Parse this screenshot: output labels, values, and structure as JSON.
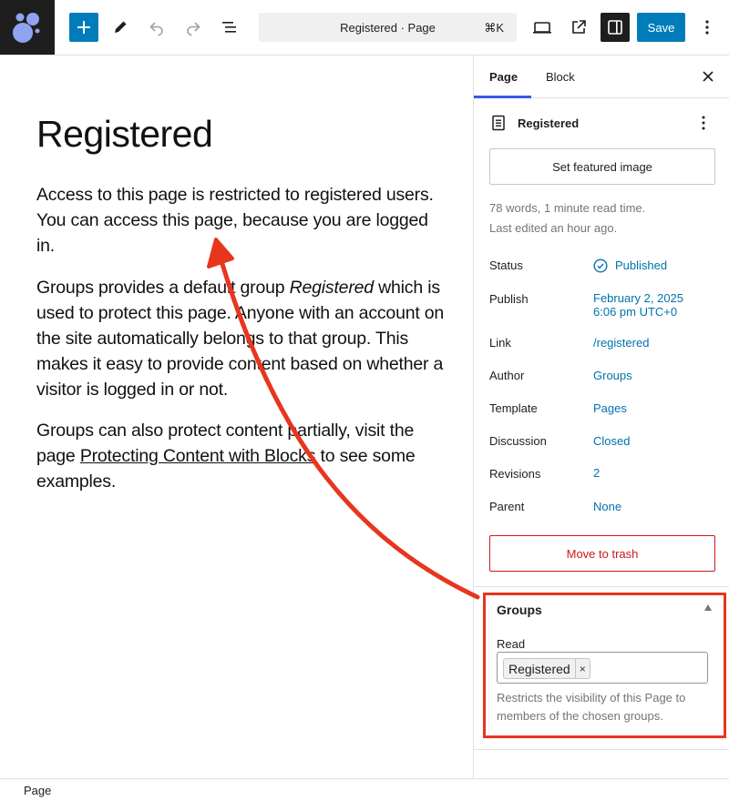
{
  "toolbar": {
    "add_icon": "plus-icon",
    "command_title": "Registered · Page",
    "command_shortcut": "⌘K",
    "save_label": "Save"
  },
  "editor": {
    "title": "Registered",
    "p1": "Access to this page is restricted to registered users. You can access this page, because you are logged in.",
    "p2_before": "Groups provides a default group ",
    "p2_em": "Registered",
    "p2_after": " which is used to protect this page. Anyone with an account on the site automatically belongs to that group. This makes it easy to provide content based on whether a visitor is logged in or not.",
    "p3_before": "Groups can also protect content partially, visit the page ",
    "p3_link": "Protecting Content with Blocks",
    "p3_after": " to see some examples."
  },
  "sidebar": {
    "tabs": [
      {
        "label": "Page"
      },
      {
        "label": "Block"
      }
    ],
    "summary_title": "Registered",
    "featured_image_label": "Set featured image",
    "meta_words": "78 words, 1 minute read time.",
    "meta_edited": "Last edited an hour ago.",
    "rows": [
      {
        "label": "Status",
        "value": "Published"
      },
      {
        "label": "Publish",
        "value": "February 2, 2025",
        "value2": "6:06 pm UTC+0"
      },
      {
        "label": "Link",
        "value": "/registered"
      },
      {
        "label": "Author",
        "value": "Groups"
      },
      {
        "label": "Template",
        "value": "Pages"
      },
      {
        "label": "Discussion",
        "value": "Closed"
      },
      {
        "label": "Revisions",
        "value": "2"
      },
      {
        "label": "Parent",
        "value": "None"
      }
    ],
    "trash_label": "Move to trash"
  },
  "groups_panel": {
    "title": "Groups",
    "read_label": "Read",
    "selected_group": "Registered",
    "remove_symbol": "×",
    "help": "Restricts the visibility of this Page to members of the chosen groups."
  },
  "footer": {
    "breadcrumb": "Page"
  },
  "colors": {
    "accent": "#007cba",
    "link": "#0073aa",
    "danger": "#cc1818",
    "annotation": "#e8351e"
  }
}
